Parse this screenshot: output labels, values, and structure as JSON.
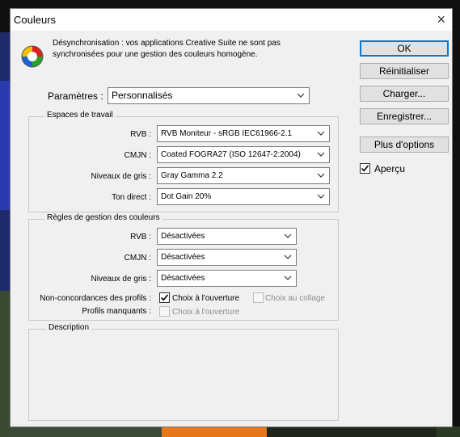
{
  "window": {
    "title": "Couleurs",
    "close_glyph": "×"
  },
  "sync": {
    "line1": "Désynchronisation : vos applications Creative Suite ne sont pas",
    "line2": "synchronisées pour une gestion des couleurs homogène."
  },
  "params": {
    "label": "Paramètres :",
    "value": "Personnalisés"
  },
  "workspaces": {
    "title": "Espaces de travail",
    "rvb_label": "RVB :",
    "rvb_value": "RVB Moniteur - sRGB IEC61966-2.1",
    "cmjn_label": "CMJN :",
    "cmjn_value": "Coated FOGRA27 (ISO 12647-2:2004)",
    "gray_label": "Niveaux de gris :",
    "gray_value": "Gray Gamma 2.2",
    "spot_label": "Ton direct :",
    "spot_value": "Dot Gain 20%"
  },
  "policies": {
    "title": "Règles de gestion des couleurs",
    "rvb_label": "RVB :",
    "rvb_value": "Désactivées",
    "cmjn_label": "CMJN :",
    "cmjn_value": "Désactivées",
    "gray_label": "Niveaux de gris :",
    "gray_value": "Désactivées",
    "mismatch_label": "Non-concordances des profils :",
    "mismatch_open": "Choix à l'ouverture",
    "mismatch_paste": "Choix au collage",
    "missing_label": "Profils manquants :",
    "missing_open": "Choix à l'ouverture"
  },
  "description": {
    "title": "Description"
  },
  "buttons": {
    "ok": "OK",
    "reset": "Réinitialiser",
    "load": "Charger...",
    "save": "Enregistrer...",
    "more": "Plus d'options"
  },
  "preview": {
    "label": "Aperçu",
    "checked": true
  },
  "colors": {
    "accent": "#0078d7",
    "dialog_bg": "#f0f0f0"
  }
}
